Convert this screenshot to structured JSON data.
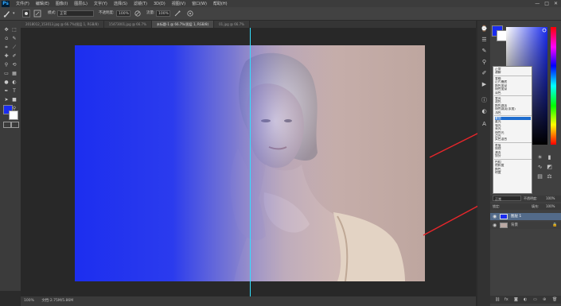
{
  "app": {
    "logo": "Ps",
    "menu": [
      "文件(F)",
      "编辑(E)",
      "图像(I)",
      "图层(L)",
      "文字(Y)",
      "选择(S)",
      "滤镜(T)",
      "3D(D)",
      "视图(V)",
      "窗口(W)",
      "帮助(H)"
    ],
    "window_controls": [
      "—",
      "□",
      "✕"
    ]
  },
  "options": {
    "mode_label": "模式:",
    "mode_value": "正常",
    "opacity_label": "不透明度:",
    "opacity_value": "100%",
    "flow_label": "流量:",
    "flow_value": "100%"
  },
  "tabs": [
    {
      "label": "2018012_153013.jpg @ 66.7%(图层 1, RGB/8)",
      "active": false
    },
    {
      "label": "15473001.jpg @ 66.7%",
      "active": false
    },
    {
      "label": "未标题-1 @ 66.7%(图层 1, RGB/8)",
      "active": true
    },
    {
      "label": "01.jpg @ 66.7%",
      "active": false
    }
  ],
  "status": {
    "zoom": "100%",
    "doc": "文档:2.75M/5.86M"
  },
  "blend_menu": {
    "groups": [
      [
        "正常",
        "溶解"
      ],
      [
        "变暗",
        "正片叠底",
        "颜色加深",
        "线性加深",
        "深色"
      ],
      [
        "变亮",
        "滤色",
        "颜色减淡",
        "线性减淡(添加)",
        "浅色"
      ],
      [
        "叠加",
        "柔光",
        "强光",
        "亮光",
        "线性光",
        "点光",
        "实色混合"
      ],
      [
        "差值",
        "排除",
        "减去",
        "划分"
      ],
      [
        "色相",
        "饱和度",
        "颜色",
        "明度"
      ]
    ],
    "selected": "叠加"
  },
  "layers": {
    "blend_value": "正常",
    "opacity_label": "不透明度:",
    "opacity_value": "100%",
    "lock_label": "锁定:",
    "fill_label": "填充:",
    "fill_value": "100%",
    "items": [
      {
        "name": "图层 1",
        "selected": true
      },
      {
        "name": "背景",
        "selected": false
      }
    ]
  },
  "colors": {
    "foreground": "#1a2cf0",
    "background": "#ffffff",
    "accent_guide": "#33e0ff",
    "annotation_arrow": "#e8262b",
    "menu_selection": "#1e6ccf"
  },
  "icons": {
    "brush": "brush-icon",
    "toolbox": [
      "move",
      "marquee",
      "lasso",
      "quick-select",
      "crop",
      "eyedropper",
      "healing",
      "brush",
      "clone-stamp",
      "history-brush",
      "eraser",
      "gradient",
      "blur",
      "dodge",
      "pen",
      "type",
      "path-select",
      "rectangle",
      "hand",
      "zoom"
    ]
  }
}
